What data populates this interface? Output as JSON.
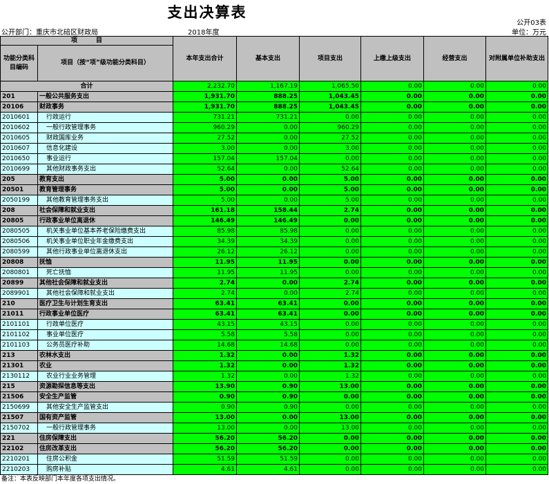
{
  "title": "支出决算表",
  "form_no": "公开03表",
  "dept_label": "公开部门：重庆市北碚区财政局",
  "year_label": "2018年度",
  "unit_label": "单位：万元",
  "header": {
    "item_group": "项　　　目",
    "code": "功能分类科目编码",
    "name": "项目（按“项”级功能分类科目）",
    "total": "本年支出合计",
    "basic": "基本支出",
    "project": "项目支出",
    "remit": "上缴上级支出",
    "business": "经营支出",
    "subsidy": "对附属单位补助支出"
  },
  "total_row": {
    "label": "合计",
    "values": [
      "2,232.70",
      "1,167.19",
      "1,065.50",
      "0.00",
      "0.00",
      "0.00"
    ]
  },
  "rows": [
    {
      "level": 0,
      "code": "201",
      "name": "一般公共服务支出",
      "values": [
        "1,931.70",
        "888.25",
        "1,043.45",
        "0.00",
        "0.00",
        "0.00"
      ]
    },
    {
      "level": 1,
      "code": "20106",
      "name": "财政事务",
      "values": [
        "1,931.70",
        "888.25",
        "1,043.45",
        "0.00",
        "0.00",
        "0.00"
      ]
    },
    {
      "level": 2,
      "code": "2010601",
      "name": "行政运行",
      "values": [
        "731.21",
        "731.21",
        "0.00",
        "0.00",
        "0.00",
        "0.00"
      ]
    },
    {
      "level": 2,
      "code": "2010602",
      "name": "一般行政管理事务",
      "values": [
        "960.29",
        "0.00",
        "960.29",
        "0.00",
        "0.00",
        "0.00"
      ]
    },
    {
      "level": 2,
      "code": "2010605",
      "name": "财政国库业务",
      "values": [
        "27.52",
        "0.00",
        "27.52",
        "0.00",
        "0.00",
        "0.00"
      ]
    },
    {
      "level": 2,
      "code": "2010607",
      "name": "信息化建设",
      "values": [
        "3.00",
        "0.00",
        "3.00",
        "0.00",
        "0.00",
        "0.00"
      ]
    },
    {
      "level": 2,
      "code": "2010650",
      "name": "事业运行",
      "values": [
        "157.04",
        "157.04",
        "0.00",
        "0.00",
        "0.00",
        "0.00"
      ]
    },
    {
      "level": 2,
      "code": "2010699",
      "name": "其他财政事务支出",
      "values": [
        "52.64",
        "0.00",
        "52.64",
        "0.00",
        "0.00",
        "0.00"
      ]
    },
    {
      "level": 0,
      "code": "205",
      "name": "教育支出",
      "values": [
        "5.00",
        "0.00",
        "5.00",
        "0.00",
        "0.00",
        "0.00"
      ]
    },
    {
      "level": 1,
      "code": "20501",
      "name": "教育管理事务",
      "values": [
        "5.00",
        "0.00",
        "5.00",
        "0.00",
        "0.00",
        "0.00"
      ]
    },
    {
      "level": 2,
      "code": "2050199",
      "name": "其他教育管理事务支出",
      "values": [
        "5.00",
        "0.00",
        "5.00",
        "0.00",
        "0.00",
        "0.00"
      ]
    },
    {
      "level": 0,
      "code": "208",
      "name": "社会保障和就业支出",
      "values": [
        "161.18",
        "158.44",
        "2.74",
        "0.00",
        "0.00",
        "0.00"
      ]
    },
    {
      "level": 1,
      "code": "20805",
      "name": "行政事业单位离退休",
      "values": [
        "146.49",
        "146.49",
        "0.00",
        "0.00",
        "0.00",
        "0.00"
      ]
    },
    {
      "level": 2,
      "code": "2080505",
      "name": "机关事业单位基本养老保险缴费支出",
      "values": [
        "85.98",
        "85.98",
        "0.00",
        "0.00",
        "0.00",
        "0.00"
      ]
    },
    {
      "level": 2,
      "code": "2080506",
      "name": "机关事业单位职业年金缴费支出",
      "values": [
        "34.39",
        "34.39",
        "0.00",
        "0.00",
        "0.00",
        "0.00"
      ]
    },
    {
      "level": 2,
      "code": "2080599",
      "name": "其他行政事业单位离退休支出",
      "values": [
        "26.12",
        "26.12",
        "0.00",
        "0.00",
        "0.00",
        "0.00"
      ]
    },
    {
      "level": 1,
      "code": "20808",
      "name": "抚恤",
      "values": [
        "11.95",
        "11.95",
        "0.00",
        "0.00",
        "0.00",
        "0.00"
      ]
    },
    {
      "level": 2,
      "code": "2080801",
      "name": "死亡抚恤",
      "values": [
        "11.95",
        "11.95",
        "0.00",
        "0.00",
        "0.00",
        "0.00"
      ]
    },
    {
      "level": 1,
      "code": "20899",
      "name": "其他社会保障和就业支出",
      "values": [
        "2.74",
        "0.00",
        "2.74",
        "0.00",
        "0.00",
        "0.00"
      ]
    },
    {
      "level": 2,
      "code": "2089901",
      "name": "其他社会保障和就业支出",
      "values": [
        "2.74",
        "0.00",
        "2.74",
        "0.00",
        "0.00",
        "0.00"
      ]
    },
    {
      "level": 0,
      "code": "210",
      "name": "医疗卫生与计划生育支出",
      "values": [
        "63.41",
        "63.41",
        "0.00",
        "0.00",
        "0.00",
        "0.00"
      ]
    },
    {
      "level": 1,
      "code": "21011",
      "name": "行政事业单位医疗",
      "values": [
        "63.41",
        "63.41",
        "0.00",
        "0.00",
        "0.00",
        "0.00"
      ]
    },
    {
      "level": 2,
      "code": "2101101",
      "name": "行政单位医疗",
      "values": [
        "43.15",
        "43.15",
        "0.00",
        "0.00",
        "0.00",
        "0.00"
      ]
    },
    {
      "level": 2,
      "code": "2101102",
      "name": "事业单位医疗",
      "values": [
        "5.58",
        "5.58",
        "0.00",
        "0.00",
        "0.00",
        "0.00"
      ]
    },
    {
      "level": 2,
      "code": "2101103",
      "name": "公务员医疗补助",
      "values": [
        "14.68",
        "14.68",
        "0.00",
        "0.00",
        "0.00",
        "0.00"
      ]
    },
    {
      "level": 0,
      "code": "213",
      "name": "农林水支出",
      "values": [
        "1.32",
        "0.00",
        "1.32",
        "0.00",
        "0.00",
        "0.00"
      ]
    },
    {
      "level": 1,
      "code": "21301",
      "name": "农业",
      "values": [
        "1.32",
        "0.00",
        "1.32",
        "0.00",
        "0.00",
        "0.00"
      ]
    },
    {
      "level": 2,
      "code": "2130112",
      "name": "农业行业业务管理",
      "values": [
        "1.32",
        "0.00",
        "1.32",
        "0.00",
        "0.00",
        "0.00"
      ]
    },
    {
      "level": 0,
      "code": "215",
      "name": "资源勘探信息等支出",
      "values": [
        "13.90",
        "0.90",
        "13.00",
        "0.00",
        "0.00",
        "0.00"
      ]
    },
    {
      "level": 1,
      "code": "21506",
      "name": "安全生产监管",
      "values": [
        "0.90",
        "0.90",
        "0.00",
        "0.00",
        "0.00",
        "0.00"
      ]
    },
    {
      "level": 2,
      "code": "2150699",
      "name": "其他安全生产监管支出",
      "values": [
        "0.90",
        "0.90",
        "0.00",
        "0.00",
        "0.00",
        "0.00"
      ]
    },
    {
      "level": 1,
      "code": "21507",
      "name": "国有资产监管",
      "values": [
        "13.00",
        "0.00",
        "13.00",
        "0.00",
        "0.00",
        "0.00"
      ]
    },
    {
      "level": 2,
      "code": "2150702",
      "name": "一般行政管理事务",
      "values": [
        "13.00",
        "0.00",
        "13.00",
        "0.00",
        "0.00",
        "0.00"
      ]
    },
    {
      "level": 0,
      "code": "221",
      "name": "住房保障支出",
      "values": [
        "56.20",
        "56.20",
        "0.00",
        "0.00",
        "0.00",
        "0.00"
      ]
    },
    {
      "level": 1,
      "code": "22102",
      "name": "住房改革支出",
      "values": [
        "56.20",
        "56.20",
        "0.00",
        "0.00",
        "0.00",
        "0.00"
      ]
    },
    {
      "level": 2,
      "code": "2210201",
      "name": "住房公积金",
      "values": [
        "51.59",
        "51.59",
        "0.00",
        "0.00",
        "0.00",
        "0.00"
      ]
    },
    {
      "level": 2,
      "code": "2210203",
      "name": "购房补贴",
      "values": [
        "4.61",
        "4.61",
        "0.00",
        "0.00",
        "0.00",
        "0.00"
      ]
    }
  ],
  "note": "备注：本表反映部门本年度各项支出情况。"
}
